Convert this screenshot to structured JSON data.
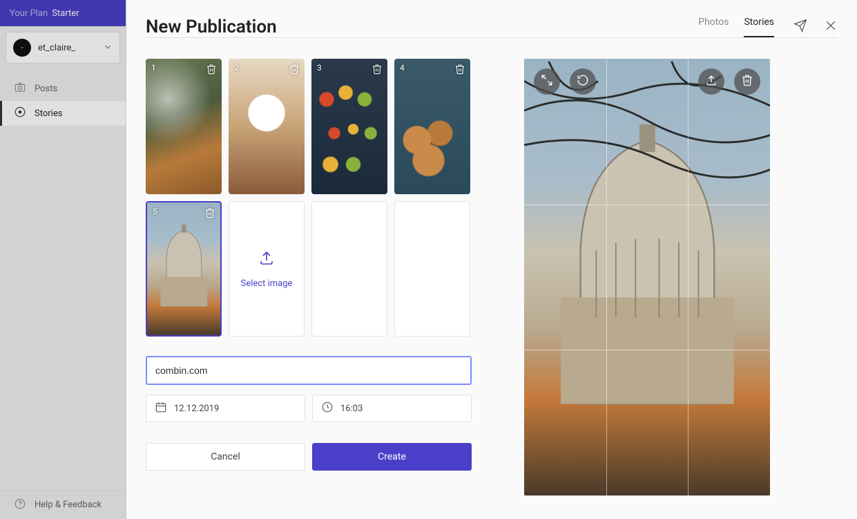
{
  "plan": {
    "label": "Your Plan",
    "name": "Starter"
  },
  "account": {
    "username": "et_claire_"
  },
  "sidebar": {
    "items": [
      {
        "label": "Posts"
      },
      {
        "label": "Stories"
      }
    ],
    "help_label": "Help & Feedback"
  },
  "header": {
    "title": "New Publication",
    "tabs": [
      {
        "label": "Photos"
      },
      {
        "label": "Stories"
      }
    ]
  },
  "thumbs": {
    "t1": "1",
    "t2": "2",
    "t3": "3",
    "t4": "4",
    "t5": "5",
    "select_label": "Select image"
  },
  "form": {
    "link_value": "combin.com",
    "date_value": "12.12.2019",
    "time_value": "16:03"
  },
  "buttons": {
    "cancel": "Cancel",
    "create": "Create"
  }
}
